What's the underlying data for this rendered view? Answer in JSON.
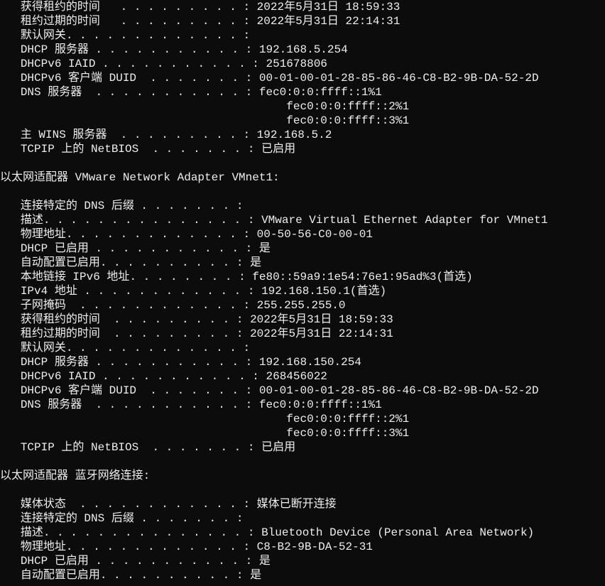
{
  "section_prev": {
    "rows": [
      {
        "label": "获得租约的时间",
        "fill": "   . . . . . . . . . : ",
        "value": "2022年5月31日 18:59:33"
      },
      {
        "label": "租约过期的时间",
        "fill": "   . . . . . . . . . : ",
        "value": "2022年5月31日 22:14:31"
      },
      {
        "label": "默认网关",
        "fill": ". . . . . . . . . . . . . : ",
        "value": ""
      },
      {
        "label": "DHCP 服务器",
        "fill": " . . . . . . . . . . . : ",
        "value": "192.168.5.254"
      },
      {
        "label": "DHCPv6 IAID",
        "fill": " . . . . . . . . . . . : ",
        "value": "251678806"
      },
      {
        "label": "DHCPv6 客户端 DUID",
        "fill": "  . . . . . . . : ",
        "value": "00-01-00-01-28-85-86-46-C8-B2-9B-DA-52-2D"
      },
      {
        "label": "DNS 服务器",
        "fill": "  . . . . . . . . . . . : ",
        "value": "fec0:0:0:ffff::1%1"
      },
      {
        "label": "",
        "fill": "                                       ",
        "value": "fec0:0:0:ffff::2%1"
      },
      {
        "label": "",
        "fill": "                                       ",
        "value": "fec0:0:0:ffff::3%1"
      },
      {
        "label": "主 WINS 服务器",
        "fill": "  . . . . . . . . . : ",
        "value": "192.168.5.2"
      },
      {
        "label": "TCPIP 上的 NetBIOS",
        "fill": "  . . . . . . . : ",
        "value": "已启用"
      }
    ]
  },
  "section_vmnet1": {
    "header": "以太网适配器 VMware Network Adapter VMnet1:",
    "rows": [
      {
        "label": "连接特定的 DNS 后缀",
        "fill": " . . . . . . . : ",
        "value": ""
      },
      {
        "label": "描述",
        "fill": ". . . . . . . . . . . . . . . : ",
        "value": "VMware Virtual Ethernet Adapter for VMnet1"
      },
      {
        "label": "物理地址",
        "fill": ". . . . . . . . . . . . . : ",
        "value": "00-50-56-C0-00-01"
      },
      {
        "label": "DHCP 已启用",
        "fill": " . . . . . . . . . . . : ",
        "value": "是"
      },
      {
        "label": "自动配置已启用",
        "fill": ". . . . . . . . . . : ",
        "value": "是"
      },
      {
        "label": "本地链接 IPv6 地址",
        "fill": ". . . . . . . . : ",
        "value": "fe80::59a9:1e54:76e1:95ad%3(首选)"
      },
      {
        "label": "IPv4 地址",
        "fill": " . . . . . . . . . . . . : ",
        "value": "192.168.150.1(首选)"
      },
      {
        "label": "子网掩码",
        "fill": "  . . . . . . . . . . . . : ",
        "value": "255.255.255.0"
      },
      {
        "label": "获得租约的时间",
        "fill": "  . . . . . . . . . : ",
        "value": "2022年5月31日 18:59:33"
      },
      {
        "label": "租约过期的时间",
        "fill": "  . . . . . . . . . : ",
        "value": "2022年5月31日 22:14:31"
      },
      {
        "label": "默认网关",
        "fill": ". . . . . . . . . . . . . : ",
        "value": ""
      },
      {
        "label": "DHCP 服务器",
        "fill": " . . . . . . . . . . . : ",
        "value": "192.168.150.254"
      },
      {
        "label": "DHCPv6 IAID",
        "fill": " . . . . . . . . . . . : ",
        "value": "268456022"
      },
      {
        "label": "DHCPv6 客户端 DUID",
        "fill": "  . . . . . . . : ",
        "value": "00-01-00-01-28-85-86-46-C8-B2-9B-DA-52-2D"
      },
      {
        "label": "DNS 服务器",
        "fill": "  . . . . . . . . . . . : ",
        "value": "fec0:0:0:ffff::1%1"
      },
      {
        "label": "",
        "fill": "                                       ",
        "value": "fec0:0:0:ffff::2%1"
      },
      {
        "label": "",
        "fill": "                                       ",
        "value": "fec0:0:0:ffff::3%1"
      },
      {
        "label": "TCPIP 上的 NetBIOS",
        "fill": "  . . . . . . . : ",
        "value": "已启用"
      }
    ]
  },
  "section_bt": {
    "header": "以太网适配器 蓝牙网络连接:",
    "rows": [
      {
        "label": "媒体状态",
        "fill": "  . . . . . . . . . . . . : ",
        "value": "媒体已断开连接"
      },
      {
        "label": "连接特定的 DNS 后缀",
        "fill": " . . . . . . . : ",
        "value": ""
      },
      {
        "label": "描述",
        "fill": ". . . . . . . . . . . . . . . : ",
        "value": "Bluetooth Device (Personal Area Network)"
      },
      {
        "label": "物理地址",
        "fill": ". . . . . . . . . . . . . : ",
        "value": "C8-B2-9B-DA-52-31"
      },
      {
        "label": "DHCP 已启用",
        "fill": " . . . . . . . . . . . : ",
        "value": "是"
      },
      {
        "label": "自动配置已启用",
        "fill": ". . . . . . . . . . : ",
        "value": "是"
      }
    ]
  }
}
